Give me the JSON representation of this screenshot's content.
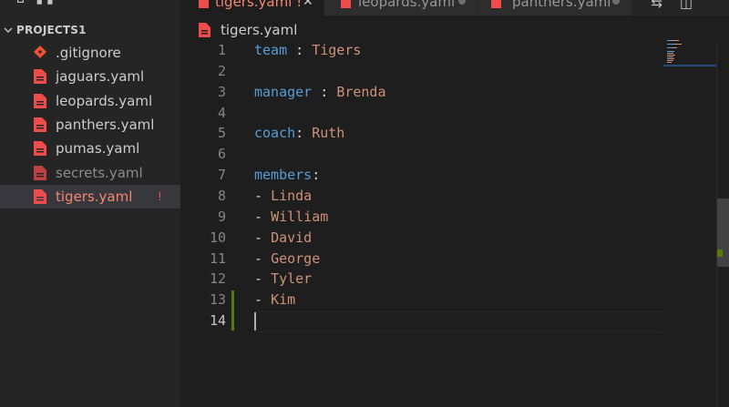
{
  "explorer": {
    "title": "PROJECTS1",
    "files": [
      {
        "name": ".gitignore",
        "kind": "git"
      },
      {
        "name": "jaguars.yaml",
        "kind": "yaml"
      },
      {
        "name": "leopards.yaml",
        "kind": "yaml"
      },
      {
        "name": "panthers.yaml",
        "kind": "yaml"
      },
      {
        "name": "pumas.yaml",
        "kind": "yaml"
      },
      {
        "name": "secrets.yaml",
        "kind": "ignored"
      },
      {
        "name": "tigers.yaml",
        "kind": "error",
        "badge": "!"
      }
    ]
  },
  "tabs": [
    {
      "label": "tigers.yaml",
      "suffix": "!",
      "active": true
    },
    {
      "label": "leopards.yaml",
      "active": false
    },
    {
      "label": "panthers.yaml",
      "active": false
    }
  ],
  "breadcrumb": {
    "file": "tigers.yaml"
  },
  "editor": {
    "lines": [
      {
        "n": "1",
        "key": "team",
        "sep": " : ",
        "val": "Tigers"
      },
      {
        "n": "2"
      },
      {
        "n": "3",
        "key": "manager",
        "sep": " : ",
        "val": "Brenda"
      },
      {
        "n": "4"
      },
      {
        "n": "5",
        "key": "coach",
        "sep": ": ",
        "val": "Ruth"
      },
      {
        "n": "6"
      },
      {
        "n": "7",
        "key": "members",
        "sep": ":"
      },
      {
        "n": "8",
        "dash": "- ",
        "val": "Linda"
      },
      {
        "n": "9",
        "dash": "- ",
        "val": "William"
      },
      {
        "n": "10",
        "dash": "- ",
        "val": "David"
      },
      {
        "n": "11",
        "dash": "- ",
        "val": "George"
      },
      {
        "n": "12",
        "dash": "- ",
        "val": "Tyler"
      },
      {
        "n": "13",
        "dash": "- ",
        "val": "Kim"
      },
      {
        "n": "14"
      }
    ],
    "current_line": "14"
  },
  "colors": {
    "key": "#569cd6",
    "value": "#ce9178",
    "error": "#f48771",
    "yaml_icon": "#f14c4c",
    "git_icon": "#f05133",
    "added": "#587c0c"
  },
  "icons": {
    "yaml": "yaml-file-icon",
    "git": "git-file-icon",
    "chevron": "chevron-down-icon",
    "compare": "compare-changes-icon",
    "split": "split-editor-icon",
    "close": "close-icon"
  }
}
